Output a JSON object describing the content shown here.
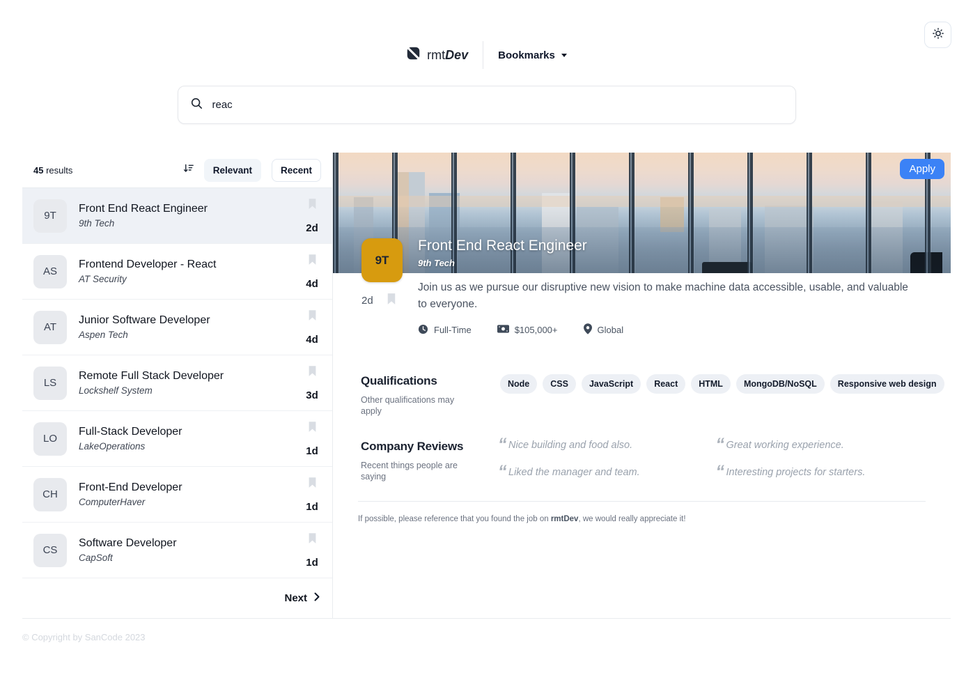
{
  "app": {
    "brand_prefix": "rmt",
    "brand_suffix": "Dev"
  },
  "colors": {
    "accent_blue": "#3b82f6",
    "company_badge_orange": "#d79b0f",
    "active_item_bg": "#eef1f6"
  },
  "icons": {
    "logo": "logo-mark",
    "theme": "sun",
    "search": "magnifier",
    "bookmarks_caret": "chevron-down",
    "sort": "sort-descending",
    "bookmark": "bookmark",
    "employment": "clock",
    "salary": "banknote",
    "location": "map-pin",
    "next": "chevron-right",
    "quote": "double-quote"
  },
  "header": {
    "bookmarks_label": "Bookmarks"
  },
  "search": {
    "value": "reac"
  },
  "results": {
    "count": "45",
    "count_suffix": "results",
    "sort": [
      {
        "label": "Relevant",
        "active": true
      },
      {
        "label": "Recent",
        "active": false
      }
    ],
    "items": [
      {
        "badge": "9T",
        "title": "Front End React Engineer",
        "company": "9th Tech",
        "days": "2d",
        "active": true
      },
      {
        "badge": "AS",
        "title": "Frontend Developer - React",
        "company": "AT Security",
        "days": "4d",
        "active": false
      },
      {
        "badge": "AT",
        "title": "Junior Software Developer",
        "company": "Aspen Tech",
        "days": "4d",
        "active": false
      },
      {
        "badge": "LS",
        "title": "Remote Full Stack Developer",
        "company": "Lockshelf System",
        "days": "3d",
        "active": false
      },
      {
        "badge": "LO",
        "title": "Full-Stack Developer",
        "company": "LakeOperations",
        "days": "1d",
        "active": false
      },
      {
        "badge": "CH",
        "title": "Front-End Developer",
        "company": "ComputerHaver",
        "days": "1d",
        "active": false
      },
      {
        "badge": "CS",
        "title": "Software Developer",
        "company": "CapSoft",
        "days": "1d",
        "active": false
      }
    ],
    "next_label": "Next"
  },
  "job": {
    "apply_label": "Apply",
    "badge": "9T",
    "title": "Front End React Engineer",
    "company": "9th Tech",
    "days": "2d",
    "description": "Join us as we pursue our disruptive new vision to make machine data accessible, usable, and valuable to everyone.",
    "meta": {
      "employment_type": "Full-Time",
      "salary": "$105,000+",
      "location": "Global"
    },
    "qualifications": {
      "heading": "Qualifications",
      "subtext": "Other qualifications may apply",
      "tags": [
        "Node",
        "CSS",
        "JavaScript",
        "React",
        "HTML",
        "MongoDB/NoSQL",
        "Responsive web design"
      ]
    },
    "reviews": {
      "heading": "Company Reviews",
      "subtext": "Recent things people are saying",
      "items": [
        "Nice building and food also.",
        "Great working experience.",
        "Liked the manager and team.",
        "Interesting projects for starters."
      ]
    },
    "footer_note_pre": "If possible, please reference that you found the job on ",
    "footer_note_brand": "rmtDev",
    "footer_note_post": ", we would really appreciate it!"
  },
  "footer": {
    "copyright": "© Copyright by SanCode 2023"
  }
}
